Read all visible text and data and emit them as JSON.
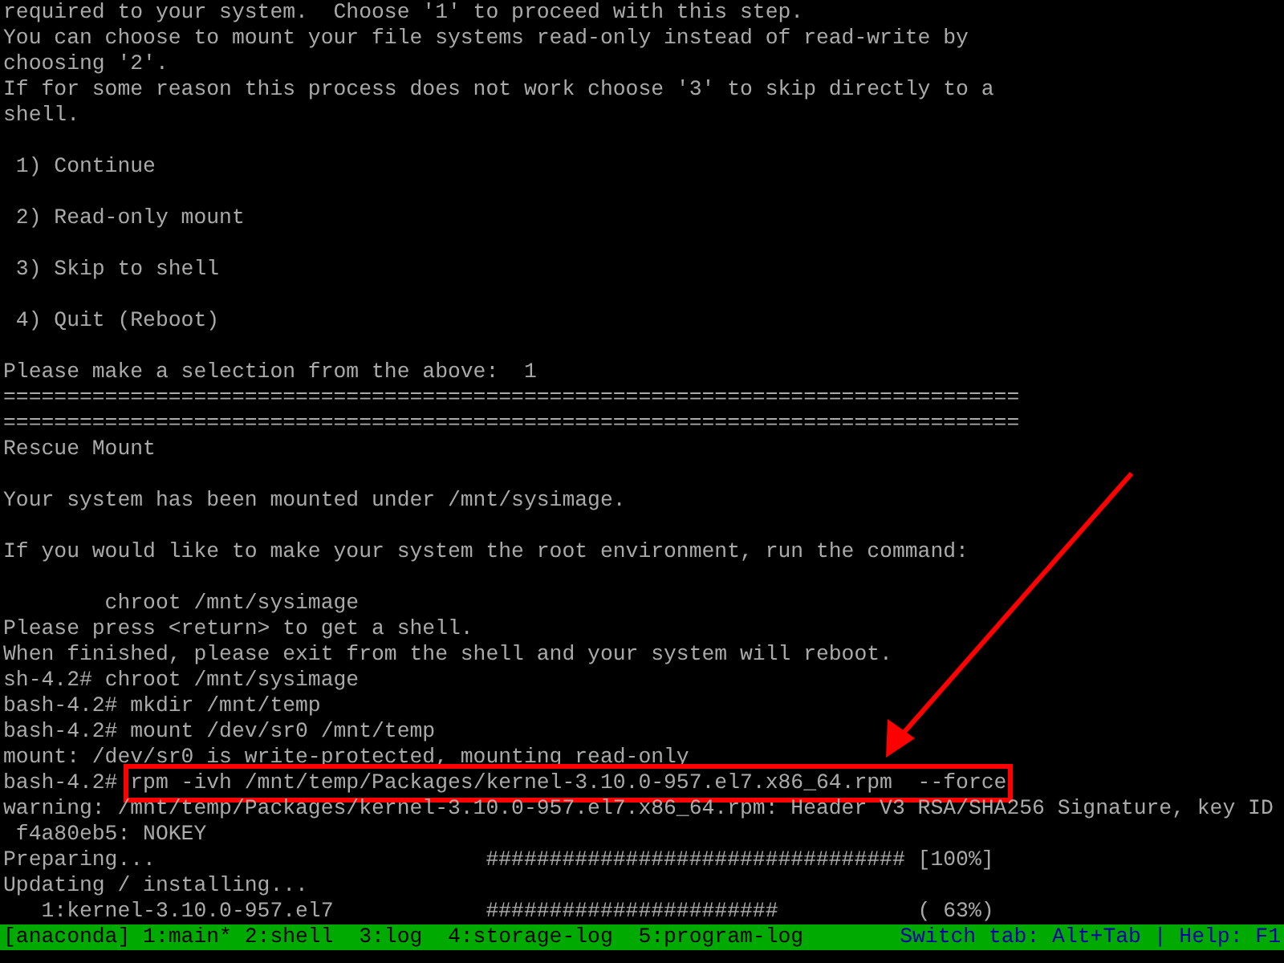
{
  "terminal": {
    "lines": [
      {
        "text": "required to your system.  Choose '1' to proceed with this step."
      },
      {
        "text": "You can choose to mount your file systems read-only instead of read-write by"
      },
      {
        "text": "choosing '2'."
      },
      {
        "text": "If for some reason this process does not work choose '3' to skip directly to a"
      },
      {
        "text": "shell."
      },
      {
        "text": " 1) Continue",
        "gap_before": true
      },
      {
        "text": " 2) Read-only mount",
        "gap_before": true
      },
      {
        "text": " 3) Skip to shell",
        "gap_before": true
      },
      {
        "text": " 4) Quit (Reboot)",
        "gap_before": true
      },
      {
        "text": "Please make a selection from the above:  1",
        "gap_before": true
      },
      {
        "text": "================================================================================"
      },
      {
        "text": "================================================================================"
      },
      {
        "text": "Rescue Mount"
      },
      {
        "text": "Your system has been mounted under /mnt/sysimage.",
        "gap_before": true
      },
      {
        "text": "If you would like to make your system the root environment, run the command:",
        "gap_before": true
      },
      {
        "text": "        chroot /mnt/sysimage",
        "gap_before": true
      },
      {
        "text": "Please press <return> to get a shell."
      },
      {
        "text": "When finished, please exit from the shell and your system will reboot."
      },
      {
        "prompt": "sh-4.2# ",
        "text": "chroot /mnt/sysimage"
      },
      {
        "prompt": "bash-4.2# ",
        "text": "mkdir /mnt/temp"
      },
      {
        "prompt": "bash-4.2# ",
        "text": "mount /dev/sr0 /mnt/temp"
      },
      {
        "text": "mount: /dev/sr0 is write-protected, mounting read-only"
      },
      {
        "prompt": "bash-4.2# ",
        "text": "rpm -ivh /mnt/temp/Packages/kernel-3.10.0-957.el7.x86_64.rpm  --force",
        "highlighted": true
      },
      {
        "text": "warning: /mnt/temp/Packages/kernel-3.10.0-957.el7.x86_64.rpm: Header V3 RSA/SHA256 Signature, key ID"
      },
      {
        "text": " f4a80eb5: NOKEY"
      },
      {
        "text": "Preparing...                          ################################# [100%]"
      },
      {
        "text": "Updating / installing..."
      },
      {
        "text": "   1:kernel-3.10.0-957.el7            #######################           ( 63%)"
      }
    ]
  },
  "status_bar": {
    "windows": "[anaconda] 1:main* 2:shell  3:log  4:storage-log  5:program-log",
    "hint": "Switch tab: Alt+Tab | Help: F1"
  }
}
